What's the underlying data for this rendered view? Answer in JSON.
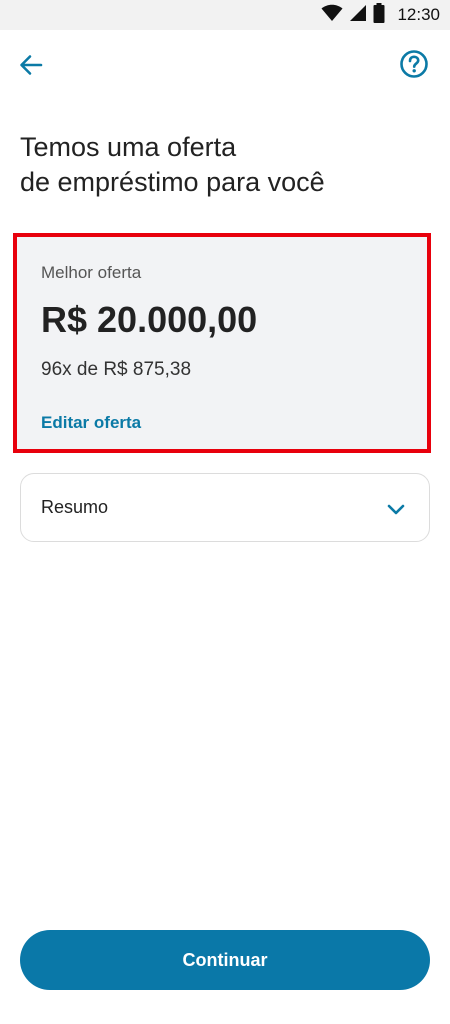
{
  "status_bar": {
    "time": "12:30",
    "icons": [
      "wifi-icon",
      "cell-signal-icon",
      "battery-icon"
    ]
  },
  "header": {
    "back_icon": "arrow-left-icon",
    "help_icon": "question-circle-icon"
  },
  "title": {
    "line1": "Temos uma oferta",
    "line2": "de empréstimo para você"
  },
  "offer_card": {
    "label": "Melhor oferta",
    "amount": "R$ 20.000,00",
    "installments": "96x de R$ 875,38",
    "edit_link": "Editar oferta",
    "highlight_color": "#e8000c"
  },
  "summary": {
    "label": "Resumo",
    "expand_icon": "chevron-down-icon",
    "expanded": false
  },
  "footer": {
    "continue_label": "Continuar"
  },
  "colors": {
    "accent": "#0a78a8",
    "link": "#0b7aa6",
    "card_bg": "#f2f3f5"
  }
}
